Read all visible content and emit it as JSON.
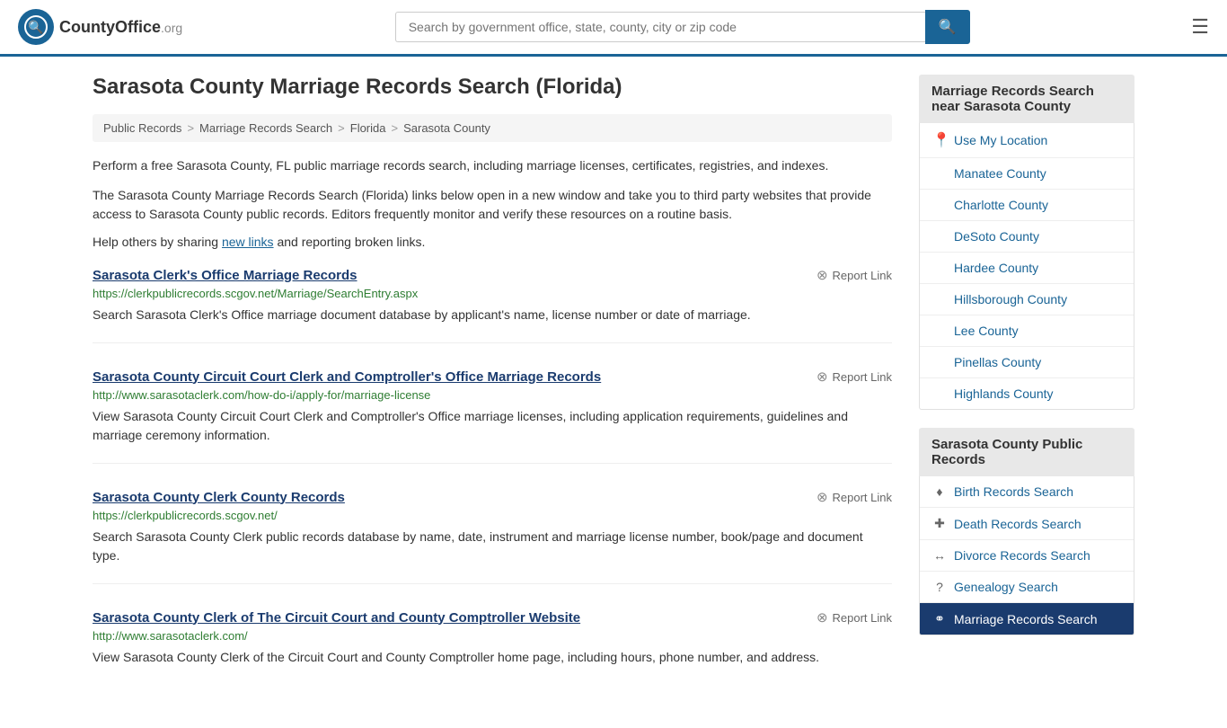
{
  "header": {
    "logo_text": "CountyOffice",
    "logo_org": ".org",
    "search_placeholder": "Search by government office, state, county, city or zip code",
    "menu_label": "☰"
  },
  "page": {
    "title": "Sarasota County Marriage Records Search (Florida)",
    "breadcrumbs": [
      {
        "label": "Public Records",
        "href": "#"
      },
      {
        "label": "Marriage Records Search",
        "href": "#"
      },
      {
        "label": "Florida",
        "href": "#"
      },
      {
        "label": "Sarasota County",
        "href": "#"
      }
    ],
    "description1": "Perform a free Sarasota County, FL public marriage records search, including marriage licenses, certificates, registries, and indexes.",
    "description2": "The Sarasota County Marriage Records Search (Florida) links below open in a new window and take you to third party websites that provide access to Sarasota County public records. Editors frequently monitor and verify these resources on a routine basis.",
    "help_text_prefix": "Help others by sharing ",
    "help_link": "new links",
    "help_text_suffix": " and reporting broken links."
  },
  "results": [
    {
      "title": "Sarasota Clerk's Office Marriage Records",
      "url": "https://clerkpublicrecords.scgov.net/Marriage/SearchEntry.aspx",
      "description": "Search Sarasota Clerk's Office marriage document database by applicant's name, license number or date of marriage.",
      "report_label": "Report Link"
    },
    {
      "title": "Sarasota County Circuit Court Clerk and Comptroller's Office Marriage Records",
      "url": "http://www.sarasotaclerk.com/how-do-i/apply-for/marriage-license",
      "description": "View Sarasota County Circuit Court Clerk and Comptroller's Office marriage licenses, including application requirements, guidelines and marriage ceremony information.",
      "report_label": "Report Link"
    },
    {
      "title": "Sarasota County Clerk County Records",
      "url": "https://clerkpublicrecords.scgov.net/",
      "description": "Search Sarasota County Clerk public records database by name, date, instrument and marriage license number, book/page and document type.",
      "report_label": "Report Link"
    },
    {
      "title": "Sarasota County Clerk of The Circuit Court and County Comptroller Website",
      "url": "http://www.sarasotaclerk.com/",
      "description": "View Sarasota County Clerk of the Circuit Court and County Comptroller home page, including hours, phone number, and address.",
      "report_label": "Report Link"
    }
  ],
  "sidebar": {
    "nearby_heading": "Marriage Records Search near Sarasota County",
    "use_my_location": "Use My Location",
    "nearby_counties": [
      "Manatee County",
      "Charlotte County",
      "DeSoto County",
      "Hardee County",
      "Hillsborough County",
      "Lee County",
      "Pinellas County",
      "Highlands County"
    ],
    "public_records_heading": "Sarasota County Public Records",
    "public_records_items": [
      {
        "icon": "♦",
        "label": "Birth Records Search"
      },
      {
        "icon": "+",
        "label": "Death Records Search"
      },
      {
        "icon": "↔",
        "label": "Divorce Records Search"
      },
      {
        "icon": "?",
        "label": "Genealogy Search"
      },
      {
        "icon": "⚭",
        "label": "Marriage Records Search"
      }
    ]
  }
}
